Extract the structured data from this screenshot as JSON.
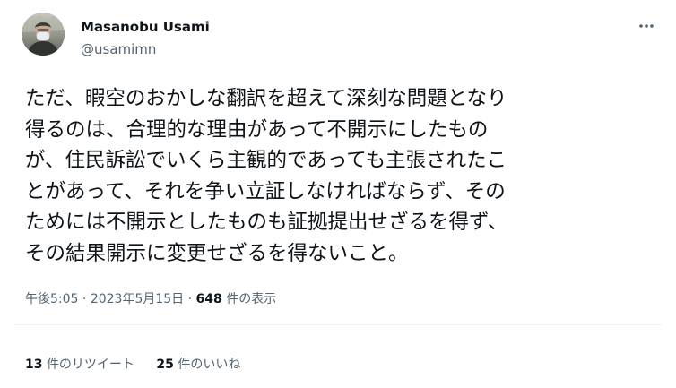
{
  "author": {
    "name": "Masanobu Usami",
    "handle": "@usamimn"
  },
  "tweet": {
    "lines": [
      "ただ、暇空のおかしな翻訳を超えて深刻な問題となり",
      "得るのは、合理的な理由があって不開示にしたもの",
      "が、住民訴訟でいくら主観的であっても主張されたこ",
      "とがあって、それを争い立証しなければならず、その",
      "ためには不開示としたものも証拠提出せざるを得ず、",
      "その結果開示に変更せざるを得ないこと。"
    ]
  },
  "meta": {
    "time": "午後5:05",
    "separator": "·",
    "date": "2023年5月15日",
    "views_count": "648",
    "views_label": "件の表示"
  },
  "stats": {
    "retweets_count": "13",
    "retweets_label": "件のリツイート",
    "likes_count": "25",
    "likes_label": "件のいいね"
  },
  "colors": {
    "text": "#0f1419",
    "secondary": "#536471",
    "divider": "#eff3f4"
  },
  "icons": {
    "more": "more-horizontal-icon"
  }
}
